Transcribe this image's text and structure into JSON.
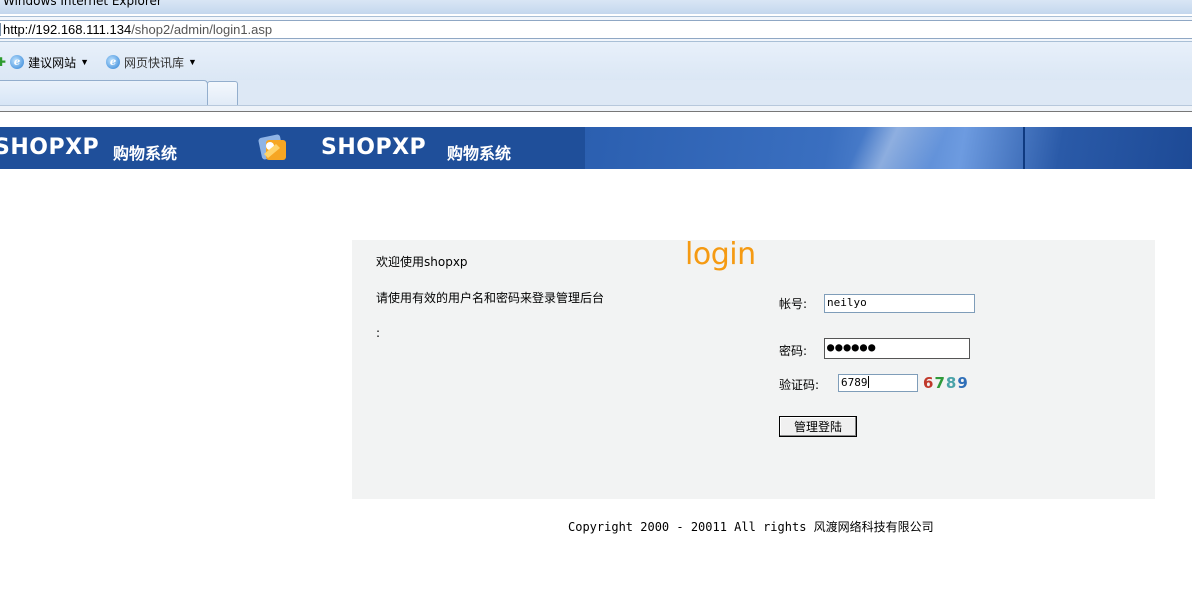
{
  "window": {
    "title": "Windows Internet Explorer"
  },
  "address_bar": {
    "url_host": "http://192.168.111.134",
    "url_path": "/shop2/admin/login1.asp"
  },
  "favorites_bar": {
    "items": [
      {
        "label": "建议网站",
        "icon": "ie-icon"
      },
      {
        "label": "网页快讯库",
        "icon": "ie-icon"
      }
    ]
  },
  "banner": {
    "logo_text_1": "SHOPXP",
    "subtitle_1": "购物系统",
    "logo_text_2": "SHOPXP",
    "subtitle_2": "购物系统",
    "colors": {
      "base": "#1f4f9a",
      "accent": "#6d9be0"
    }
  },
  "login_panel": {
    "welcome": "欢迎使用shopxp",
    "instruction": "请使用有效的用户名和密码来登录管理后台",
    "note": ":",
    "heading": "login",
    "heading_color": "#f59a12",
    "username_label": "帐号:",
    "username_value": "neilyo",
    "password_label": "密码:",
    "password_mask": "●●●●●●",
    "captcha_label": "验证码:",
    "captcha_input": "6789",
    "captcha_digits": [
      {
        "char": "6",
        "color": "#c0392b"
      },
      {
        "char": "7",
        "color": "#2f9a3a"
      },
      {
        "char": "8",
        "color": "#4aa3a8"
      },
      {
        "char": "9",
        "color": "#2f6fb8"
      }
    ],
    "submit_label": "管理登陆"
  },
  "footer": {
    "copyright": "Copyright 2000 - 20011 All rights 风渡网络科技有限公司"
  }
}
